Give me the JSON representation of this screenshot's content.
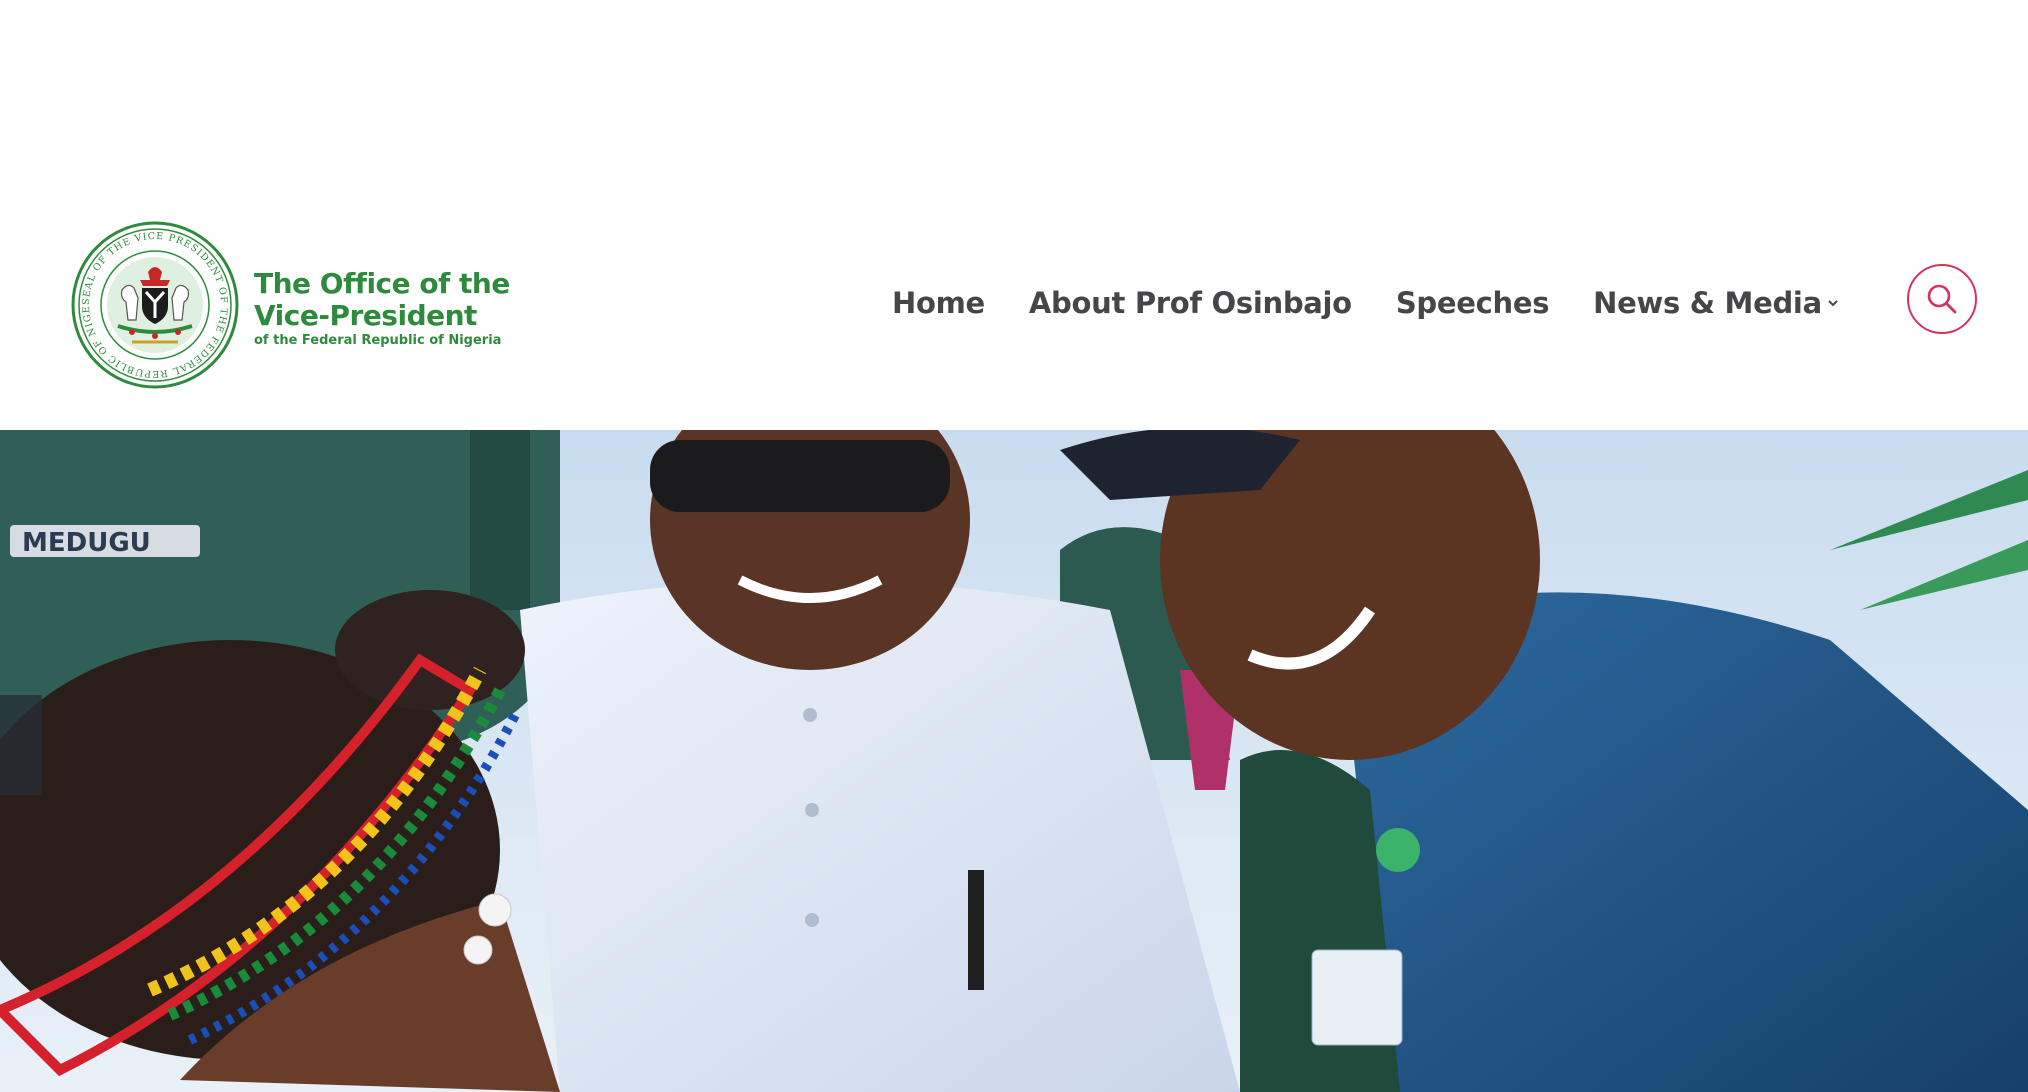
{
  "header": {
    "brand": {
      "line1": "The Office of the",
      "line2": "Vice-President",
      "line3": "of the Federal Republic of Nigeria"
    },
    "seal_text": "SEAL OF THE VICE PRESIDENT OF THE FEDERAL REPUBLIC OF NIGERIA",
    "nav": [
      {
        "label": "Home"
      },
      {
        "label": "About Prof Osinbajo"
      },
      {
        "label": "Speeches"
      },
      {
        "label": "News & Media",
        "has_dropdown": true
      }
    ],
    "search_icon": "search-icon"
  },
  "hero": {
    "badge_text": "MEDUGU"
  },
  "colors": {
    "brand_green": "#2e8b3d",
    "nav_text": "#45464a",
    "search_accent": "#d6335a"
  }
}
